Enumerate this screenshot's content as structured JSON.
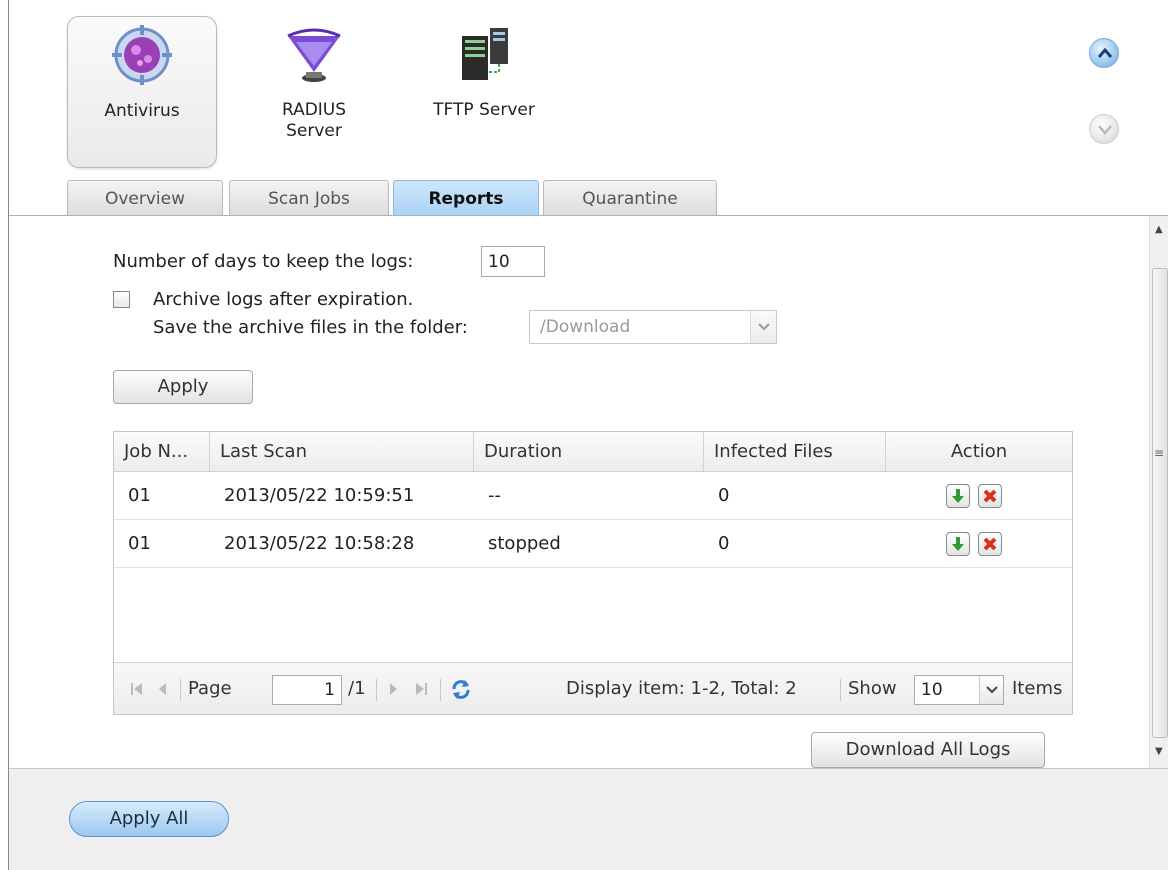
{
  "apps": [
    {
      "label": "Antivirus",
      "icon": "antivirus-icon",
      "active": true
    },
    {
      "label": "RADIUS Server",
      "icon": "radius-server-icon",
      "active": false
    },
    {
      "label": "TFTP Server",
      "icon": "tftp-server-icon",
      "active": false
    }
  ],
  "tabs": [
    {
      "label": "Overview"
    },
    {
      "label": "Scan Jobs"
    },
    {
      "label": "Reports",
      "active": true
    },
    {
      "label": "Quarantine"
    }
  ],
  "reports": {
    "days_label": "Number of days to keep the logs:",
    "days_value": "10",
    "archive_label": "Archive logs after expiration.",
    "archive_checked": false,
    "folder_label": "Save the archive files in the folder:",
    "folder_value": "/Download",
    "apply_label": "Apply"
  },
  "grid": {
    "columns": [
      "Job N...",
      "Last Scan",
      "Duration",
      "Infected Files",
      "Action"
    ],
    "rows": [
      {
        "job": "01",
        "last_scan": "2013/05/22 10:59:51",
        "duration": "--",
        "infected": "0"
      },
      {
        "job": "01",
        "last_scan": "2013/05/22 10:58:28",
        "duration": "stopped",
        "infected": "0"
      }
    ]
  },
  "pager": {
    "page_label": "Page",
    "page_value": "1",
    "page_total": "/1",
    "display_text": "Display item: 1-2, Total: 2",
    "show_label": "Show",
    "show_value": "10",
    "items_label": "Items"
  },
  "download_all_label": "Download All Logs",
  "apply_all_label": "Apply All",
  "colors": {
    "active_tab": "#a9d2f4",
    "apply_all": "#9cc8f0",
    "download_icon": "#2e9a3a",
    "delete_icon": "#d8301e"
  }
}
